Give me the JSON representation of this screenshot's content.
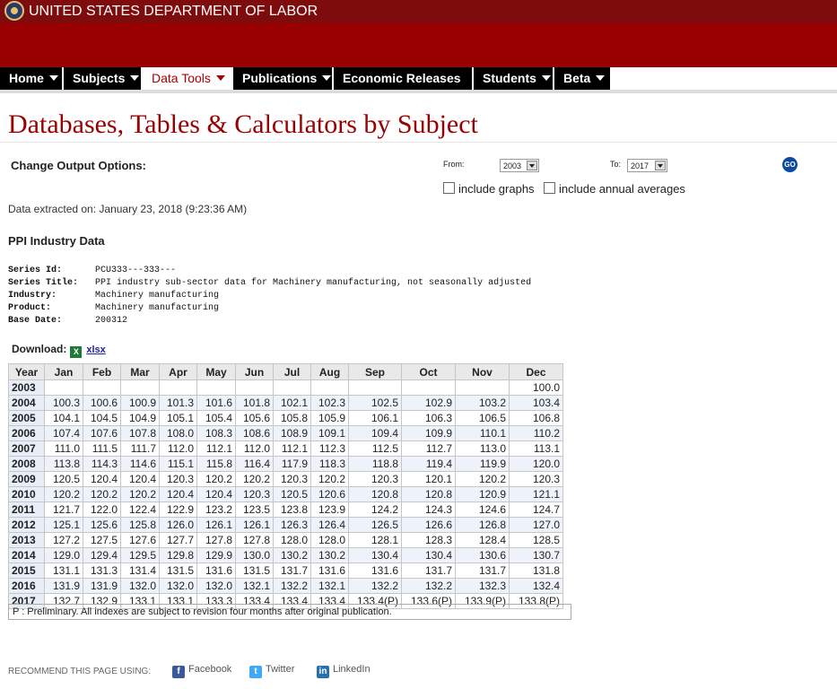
{
  "header": {
    "department": "UNITED STATES DEPARTMENT OF LABOR",
    "brand_color": "#990000"
  },
  "nav": {
    "items": [
      {
        "label": "Home",
        "active": false
      },
      {
        "label": "Subjects",
        "active": false
      },
      {
        "label": "Data Tools",
        "active": true
      },
      {
        "label": "Publications",
        "active": false
      },
      {
        "label": "Economic Releases",
        "active": false
      },
      {
        "label": "Students",
        "active": false
      },
      {
        "label": "Beta",
        "active": false
      }
    ]
  },
  "page": {
    "title": "Databases, Tables & Calculators by Subject"
  },
  "options": {
    "label": "Change Output Options:",
    "from_label": "From:",
    "from_value": "2003",
    "to_label": "To:",
    "to_value": "2017",
    "go_label": "GO",
    "include_graphs": "include graphs",
    "include_annual_averages": "include annual averages"
  },
  "extracted": "Data extracted on: January 23, 2018 (9:23:36 AM)",
  "series": {
    "heading": "PPI Industry Data",
    "fields": [
      {
        "key": "Series Id:",
        "value": "PCU333---333---"
      },
      {
        "key": "Series Title:",
        "value": "PPI industry sub-sector data for Machinery manufacturing, not seasonally adjusted"
      },
      {
        "key": "Industry:",
        "value": "Machinery manufacturing"
      },
      {
        "key": "Product:",
        "value": "Machinery manufacturing"
      },
      {
        "key": "Base Date:",
        "value": "200312"
      }
    ]
  },
  "download": {
    "label": "Download:",
    "icon": "excel-icon",
    "link": "xlsx"
  },
  "table": {
    "columns": [
      "Year",
      "Jan",
      "Feb",
      "Mar",
      "Apr",
      "May",
      "Jun",
      "Jul",
      "Aug",
      "Sep",
      "Oct",
      "Nov",
      "Dec"
    ],
    "rows": [
      [
        "2003",
        "",
        "",
        "",
        "",
        "",
        "",
        "",
        "",
        "",
        "",
        "",
        "100.0"
      ],
      [
        "2004",
        "100.3",
        "100.6",
        "100.9",
        "101.3",
        "101.6",
        "101.8",
        "102.1",
        "102.3",
        "102.5",
        "102.9",
        "103.2",
        "103.4"
      ],
      [
        "2005",
        "104.1",
        "104.5",
        "104.9",
        "105.1",
        "105.4",
        "105.6",
        "105.8",
        "105.9",
        "106.1",
        "106.3",
        "106.5",
        "106.8"
      ],
      [
        "2006",
        "107.4",
        "107.6",
        "107.8",
        "108.0",
        "108.3",
        "108.6",
        "108.9",
        "109.1",
        "109.4",
        "109.9",
        "110.1",
        "110.2"
      ],
      [
        "2007",
        "111.0",
        "111.5",
        "111.7",
        "112.0",
        "112.1",
        "112.0",
        "112.1",
        "112.3",
        "112.5",
        "112.7",
        "113.0",
        "113.1"
      ],
      [
        "2008",
        "113.8",
        "114.3",
        "114.6",
        "115.1",
        "115.8",
        "116.4",
        "117.9",
        "118.3",
        "118.8",
        "119.4",
        "119.9",
        "120.0"
      ],
      [
        "2009",
        "120.5",
        "120.4",
        "120.4",
        "120.3",
        "120.2",
        "120.2",
        "120.3",
        "120.2",
        "120.3",
        "120.1",
        "120.2",
        "120.3"
      ],
      [
        "2010",
        "120.2",
        "120.2",
        "120.2",
        "120.4",
        "120.4",
        "120.3",
        "120.5",
        "120.6",
        "120.8",
        "120.8",
        "120.9",
        "121.1"
      ],
      [
        "2011",
        "121.7",
        "122.0",
        "122.4",
        "122.9",
        "123.2",
        "123.5",
        "123.8",
        "123.9",
        "124.2",
        "124.3",
        "124.6",
        "124.7"
      ],
      [
        "2012",
        "125.1",
        "125.6",
        "125.8",
        "126.0",
        "126.1",
        "126.1",
        "126.3",
        "126.4",
        "126.5",
        "126.6",
        "126.8",
        "127.0"
      ],
      [
        "2013",
        "127.2",
        "127.5",
        "127.6",
        "127.7",
        "127.8",
        "127.8",
        "128.0",
        "128.0",
        "128.1",
        "128.3",
        "128.4",
        "128.5"
      ],
      [
        "2014",
        "129.0",
        "129.4",
        "129.5",
        "129.8",
        "129.9",
        "130.0",
        "130.2",
        "130.2",
        "130.4",
        "130.4",
        "130.6",
        "130.7"
      ],
      [
        "2015",
        "131.1",
        "131.3",
        "131.4",
        "131.5",
        "131.6",
        "131.5",
        "131.7",
        "131.6",
        "131.6",
        "131.7",
        "131.7",
        "131.8"
      ],
      [
        "2016",
        "131.9",
        "131.9",
        "132.0",
        "132.0",
        "132.0",
        "132.1",
        "132.2",
        "132.1",
        "132.2",
        "132.2",
        "132.3",
        "132.4"
      ],
      [
        "2017",
        "132.7",
        "132.9",
        "133.1",
        "133.1",
        "133.3",
        "133.4",
        "133.4",
        "133.4",
        "133.4(P)",
        "133.6(P)",
        "133.9(P)",
        "133.8(P)"
      ]
    ],
    "note": "P : Preliminary. All indexes are subject to revision four months after original publication."
  },
  "footer": {
    "recommend": "RECOMMEND THIS PAGE USING:",
    "share": [
      {
        "label": "Facebook",
        "icon": "facebook-icon",
        "glyph": "f",
        "color": "#3b5998"
      },
      {
        "label": "Twitter",
        "icon": "twitter-icon",
        "glyph": "t",
        "color": "#3fa9f5"
      },
      {
        "label": "LinkedIn",
        "icon": "linkedin-icon",
        "glyph": "in",
        "color": "#2a6fb0"
      }
    ]
  }
}
